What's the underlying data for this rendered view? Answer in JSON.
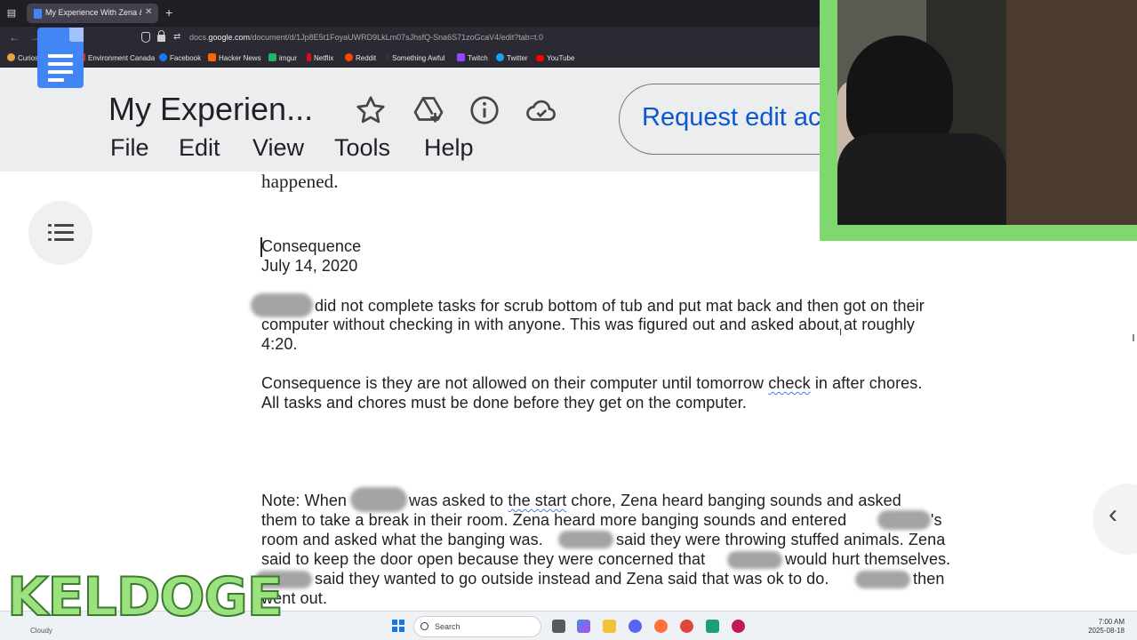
{
  "browser": {
    "tab_title": "My Experience With Zena & Po",
    "tab_close": "✕",
    "new_tab": "+",
    "nav_back": "←",
    "nav_forward": "→",
    "nav_reload": "↻",
    "url_prefix": "docs.",
    "url_domain": "google.com",
    "url_path": "/document/d/1Jp8E5t1FoyaUWRD9LkLm07sJhsfQ-Sna6S71zoGcaV4/edit?tab=t.0",
    "bookmarks": [
      {
        "label": "CuriosityStream",
        "color": "#e8a33c"
      },
      {
        "label": "Environment Canada",
        "color": "#d93025"
      },
      {
        "label": "Facebook",
        "color": "#1877f2"
      },
      {
        "label": "Hacker News",
        "color": "#ff6600"
      },
      {
        "label": "imgur",
        "color": "#1bb76e"
      },
      {
        "label": "Netflix",
        "color": "#e50914"
      },
      {
        "label": "Reddit",
        "color": "#ff4500"
      },
      {
        "label": "Something Awful",
        "color": "#333333"
      },
      {
        "label": "Twitch",
        "color": "#9146ff"
      },
      {
        "label": "Twitter",
        "color": "#1da1f2"
      },
      {
        "label": "YouTube",
        "color": "#ff0000"
      }
    ]
  },
  "docs": {
    "title": "My Experien...",
    "menu": [
      "File",
      "Edit",
      "View",
      "Tools",
      "Help"
    ],
    "request_edit_label": "Request edit ac",
    "accent_color": "#0b57d0"
  },
  "document": {
    "line_happened": "happened.",
    "heading": "Consequence",
    "date": "July 14, 2020",
    "para1_lines": [
      "did not complete tasks for scrub bottom of tub and put mat back and then got on their",
      "computer without checking in with anyone. This was figured out and asked about at roughly",
      "4:20."
    ],
    "para2_lines": [
      "Consequence is they are not allowed on their computer until tomorrow check in after chores.",
      "All tasks and chores must be done before they get on the computer."
    ],
    "para3": {
      "l1_a": "Note: When",
      "l1_b": "was asked to the start chore, Zena heard banging sounds and asked",
      "l2_a": "them to take a break in their room. Zena heard more banging sounds and entered",
      "l2_b": "'s",
      "l3_a": "room and asked what the banging was.",
      "l3_b": "said they were throwing stuffed animals. Zena",
      "l4_a": "said to keep the door open because they were concerned that",
      "l4_b": "would hurt themselves.",
      "l5_a": "said they wanted to go outside instead and Zena said that was ok to do.",
      "l5_b": "then",
      "l6": "went out."
    }
  },
  "taskbar": {
    "weather": "Cloudy",
    "search_label": "Search",
    "time": "7:00 AM",
    "date": "2025-08-18"
  },
  "overlay": {
    "watermark": "KELDOGE",
    "cam_border_color": "#7ed86e"
  }
}
